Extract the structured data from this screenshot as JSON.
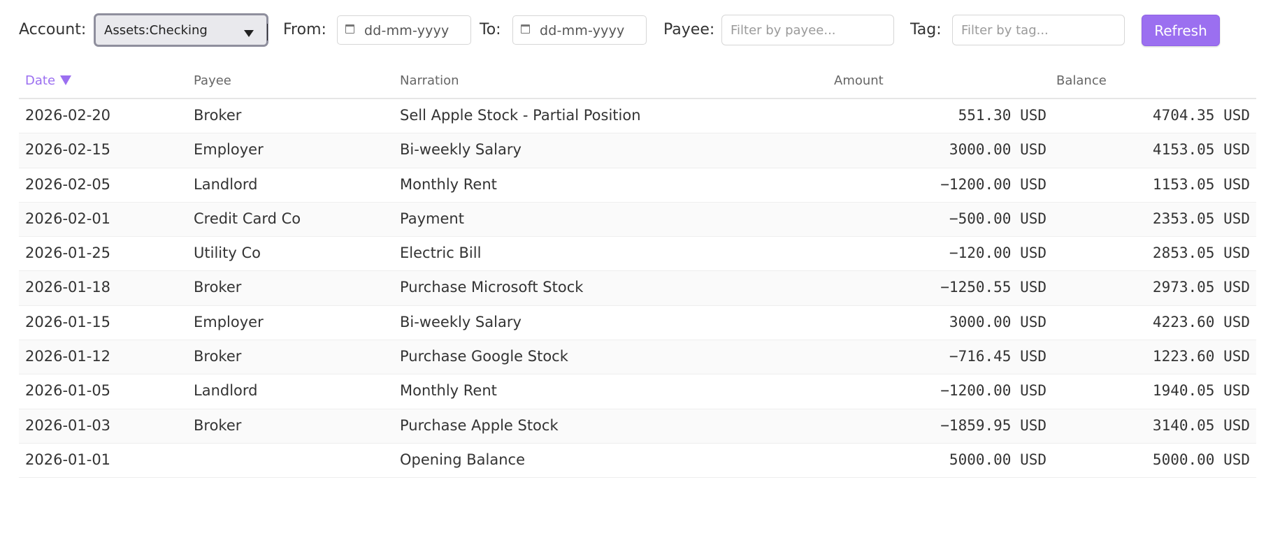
{
  "toolbar": {
    "account_label": "Account:",
    "account_value": "Assets:Checking",
    "from_label": "From:",
    "from_placeholder": "dd-mm-yyyy",
    "to_label": "To:",
    "to_placeholder": "dd-mm-yyyy",
    "payee_label": "Payee:",
    "payee_placeholder": "Filter by payee...",
    "tag_label": "Tag:",
    "tag_placeholder": "Filter by tag...",
    "refresh_label": "Refresh"
  },
  "colors": {
    "accent": "#9b6ff0",
    "select_bg": "#e9e9ed",
    "row_alt_bg": "#fafafa"
  },
  "table": {
    "sort_column": "Date",
    "sort_direction": "descending",
    "columns": [
      "Date",
      "Payee",
      "Narration",
      "Amount",
      "Balance"
    ],
    "rows": [
      {
        "date": "2026-02-20",
        "payee": "Broker",
        "narration": "Sell Apple Stock - Partial Position",
        "amount": "551.30 USD",
        "balance": "4704.35 USD"
      },
      {
        "date": "2026-02-15",
        "payee": "Employer",
        "narration": "Bi-weekly Salary",
        "amount": "3000.00 USD",
        "balance": "4153.05 USD"
      },
      {
        "date": "2026-02-05",
        "payee": "Landlord",
        "narration": "Monthly Rent",
        "amount": "−1200.00 USD",
        "balance": "1153.05 USD"
      },
      {
        "date": "2026-02-01",
        "payee": "Credit Card Co",
        "narration": "Payment",
        "amount": "−500.00 USD",
        "balance": "2353.05 USD"
      },
      {
        "date": "2026-01-25",
        "payee": "Utility Co",
        "narration": "Electric Bill",
        "amount": "−120.00 USD",
        "balance": "2853.05 USD"
      },
      {
        "date": "2026-01-18",
        "payee": "Broker",
        "narration": "Purchase Microsoft Stock",
        "amount": "−1250.55 USD",
        "balance": "2973.05 USD"
      },
      {
        "date": "2026-01-15",
        "payee": "Employer",
        "narration": "Bi-weekly Salary",
        "amount": "3000.00 USD",
        "balance": "4223.60 USD"
      },
      {
        "date": "2026-01-12",
        "payee": "Broker",
        "narration": "Purchase Google Stock",
        "amount": "−716.45 USD",
        "balance": "1223.60 USD"
      },
      {
        "date": "2026-01-05",
        "payee": "Landlord",
        "narration": "Monthly Rent",
        "amount": "−1200.00 USD",
        "balance": "1940.05 USD"
      },
      {
        "date": "2026-01-03",
        "payee": "Broker",
        "narration": "Purchase Apple Stock",
        "amount": "−1859.95 USD",
        "balance": "3140.05 USD"
      },
      {
        "date": "2026-01-01",
        "payee": "",
        "narration": "Opening Balance",
        "amount": "5000.00 USD",
        "balance": "5000.00 USD"
      }
    ]
  }
}
